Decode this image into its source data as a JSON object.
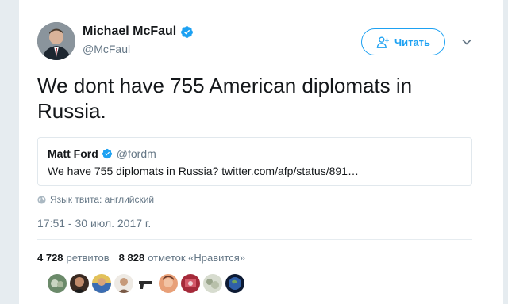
{
  "author": {
    "name": "Michael McFaul",
    "handle": "@McFaul",
    "verified_icon": "verified-badge-icon"
  },
  "follow_button": {
    "label": "Читать",
    "icon": "add-user-icon"
  },
  "tweet": {
    "text": "We dont have 755 American diplomats in Russia."
  },
  "quoted_tweet": {
    "name": "Matt Ford",
    "handle": "@fordm",
    "text": "We have 755 diplomats in Russia? twitter.com/afp/status/891…"
  },
  "language_note": "Язык твита: английский",
  "timestamp": "17:51 - 30 июл. 2017 г.",
  "stats": {
    "retweets_count": "4 728",
    "retweets_label": "ретвитов",
    "likes_count": "8 828",
    "likes_label": "отметок «Нравится»"
  },
  "colors": {
    "accent": "#1da1f2",
    "secondary_text": "#657786",
    "page_bg": "#e6ecf0"
  }
}
